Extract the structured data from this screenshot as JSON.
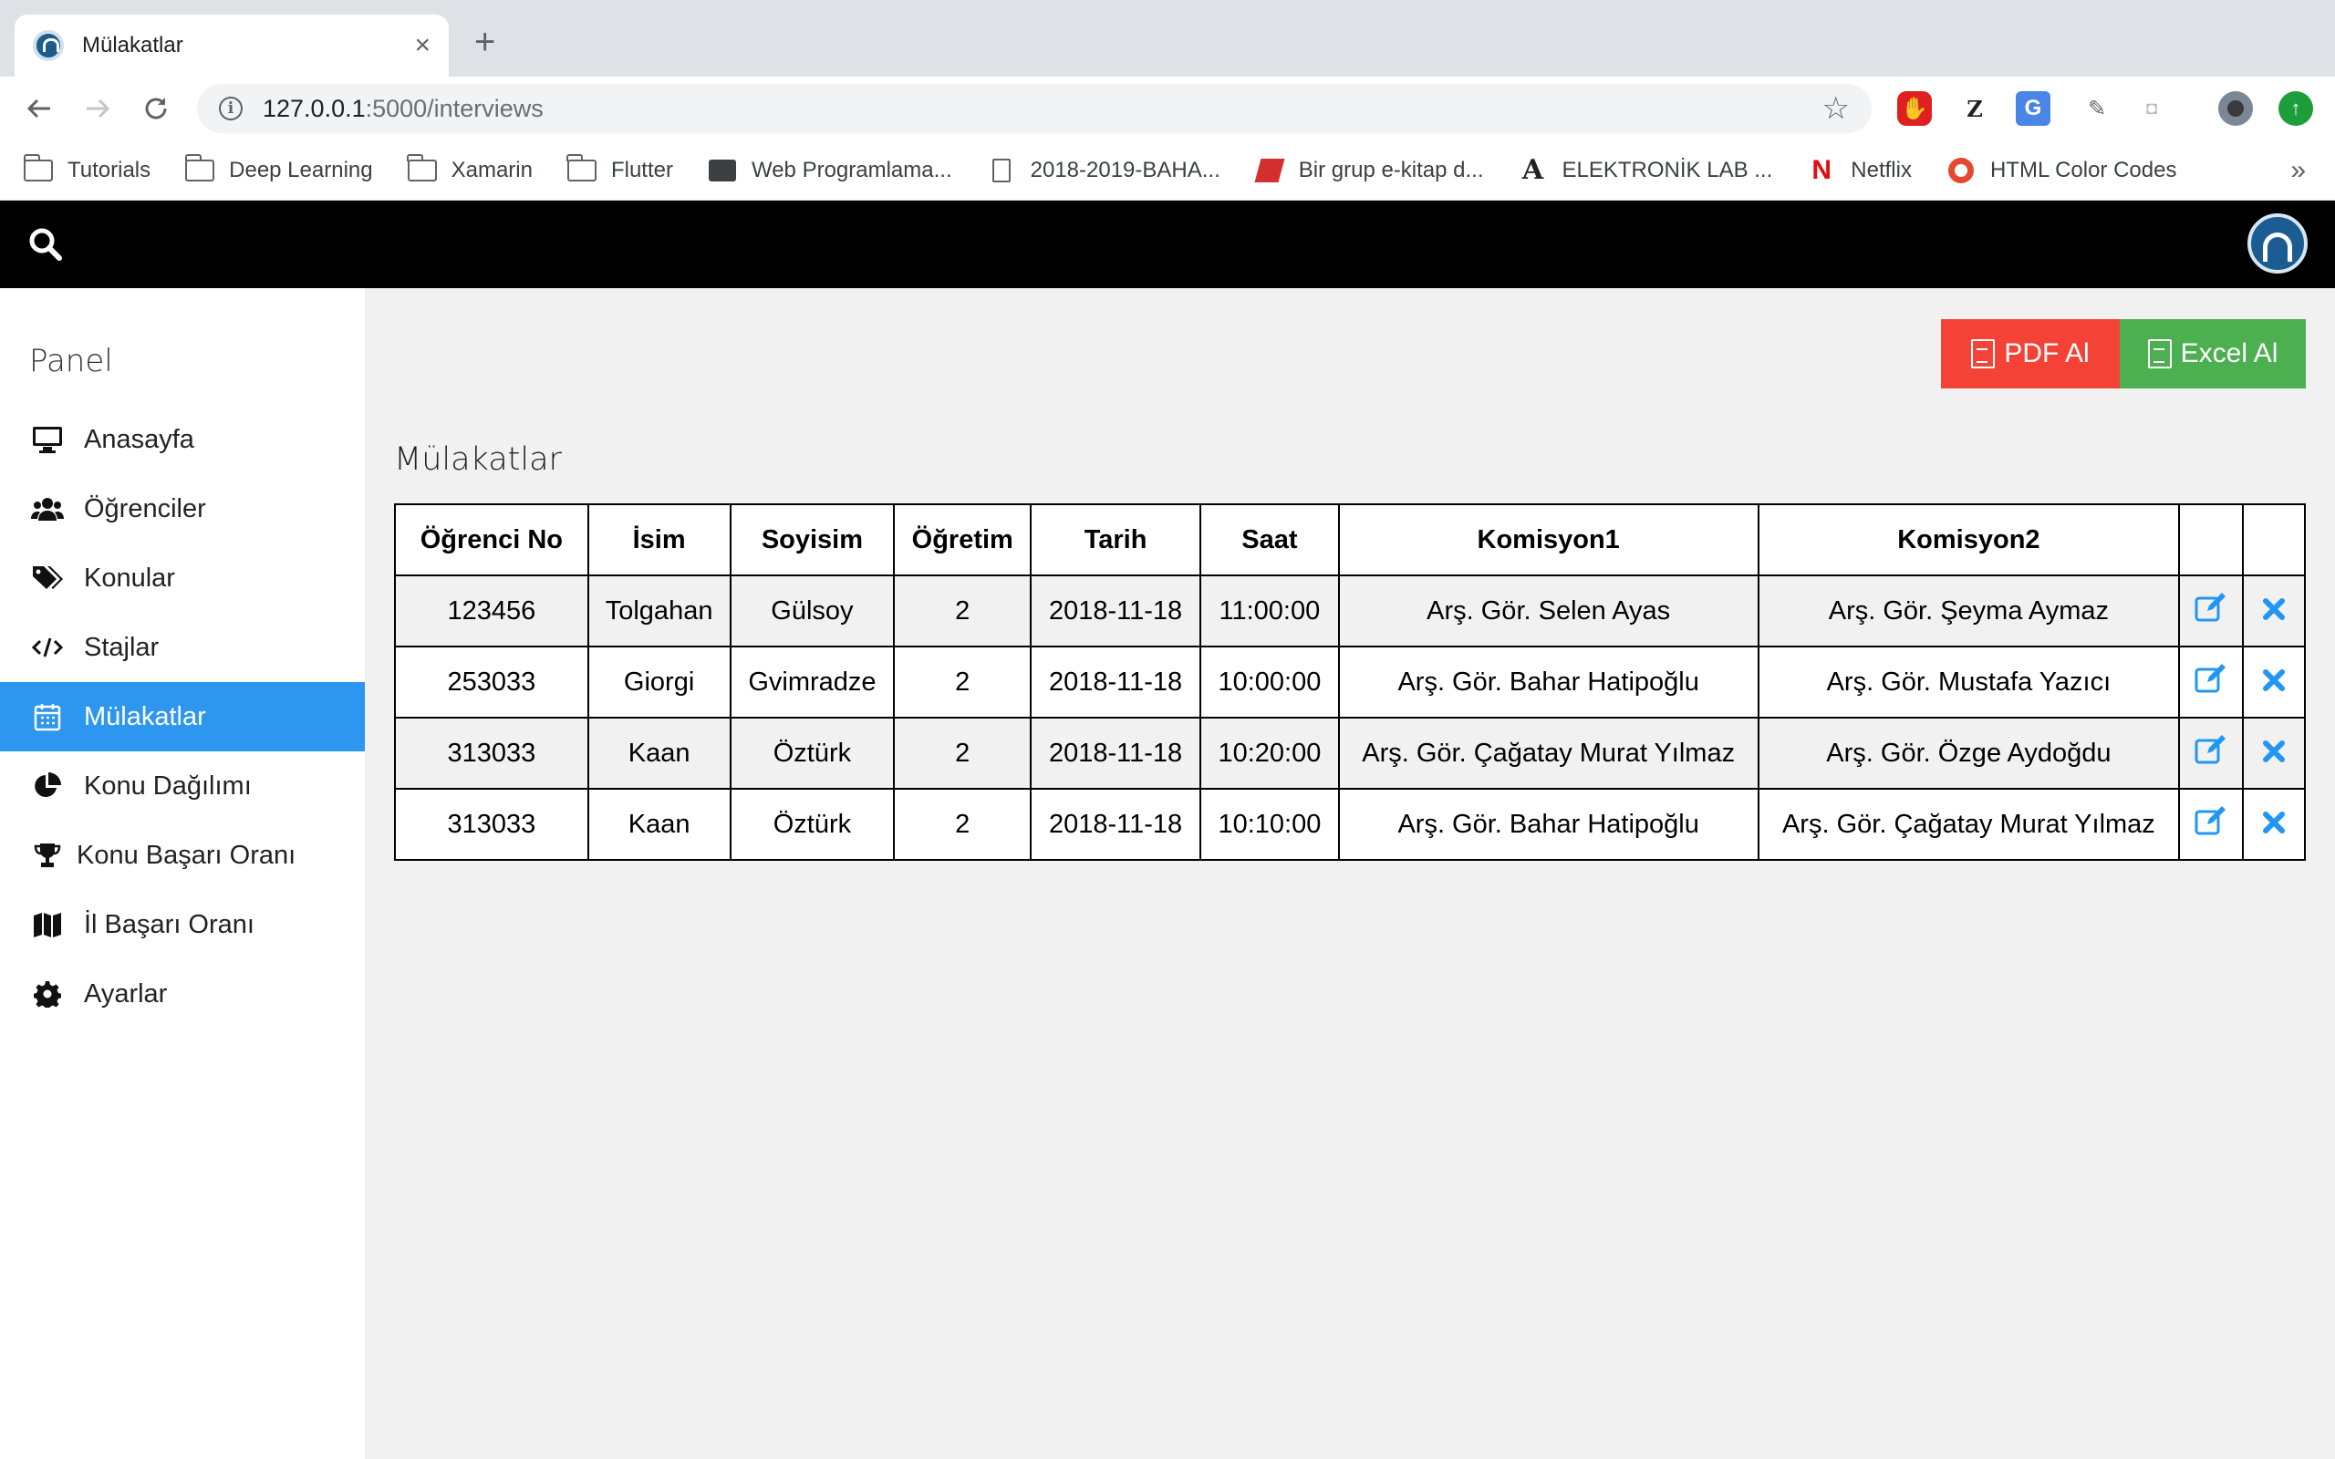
{
  "browser": {
    "tab_title": "Mülakatlar",
    "url_host": "127.0.0.1",
    "url_path": ":5000/interviews"
  },
  "bookmarks": [
    {
      "label": "Tutorials",
      "icon": "folder-icon"
    },
    {
      "label": "Deep Learning",
      "icon": "folder-icon"
    },
    {
      "label": "Xamarin",
      "icon": "folder-icon"
    },
    {
      "label": "Flutter",
      "icon": "folder-icon"
    },
    {
      "label": "Web Programlama...",
      "icon": "contact-icon"
    },
    {
      "label": "2018-2019-BAHA...",
      "icon": "document-icon"
    },
    {
      "label": "Bir grup e-kitap d...",
      "icon": "book-icon"
    },
    {
      "label": "ELEKTRONİK LAB ...",
      "icon": "font-a-icon"
    },
    {
      "label": "Netflix",
      "icon": "netflix-icon"
    },
    {
      "label": "HTML Color Codes",
      "icon": "color-wheel-icon"
    }
  ],
  "sidebar": {
    "title": "Panel",
    "items": [
      {
        "label": "Anasayfa",
        "icon": "desktop-icon"
      },
      {
        "label": "Öğrenciler",
        "icon": "users-icon"
      },
      {
        "label": "Konular",
        "icon": "tags-icon"
      },
      {
        "label": "Stajlar",
        "icon": "code-icon"
      },
      {
        "label": "Mülakatlar",
        "icon": "calendar-icon",
        "active": true
      },
      {
        "label": "Konu Dağılımı",
        "icon": "pie-chart-icon"
      },
      {
        "label": "Konu Başarı Oranı",
        "icon": "trophy-icon"
      },
      {
        "label": "İl Başarı Oranı",
        "icon": "map-icon"
      },
      {
        "label": "Ayarlar",
        "icon": "gear-icon"
      }
    ]
  },
  "actions": {
    "pdf_label": "PDF Al",
    "excel_label": "Excel Al",
    "pdf_color": "#f44336",
    "excel_color": "#4caf50"
  },
  "page_title": "Mülakatlar",
  "table": {
    "headers": [
      "Öğrenci No",
      "İsim",
      "Soyisim",
      "Öğretim",
      "Tarih",
      "Saat",
      "Komisyon1",
      "Komisyon2",
      "",
      ""
    ],
    "rows": [
      [
        "123456",
        "Tolgahan",
        "Gülsoy",
        "2",
        "2018-11-18",
        "11:00:00",
        "Arş. Gör. Selen Ayas",
        "Arş. Gör. Şeyma Aymaz"
      ],
      [
        "253033",
        "Giorgi",
        "Gvimradze",
        "2",
        "2018-11-18",
        "10:00:00",
        "Arş. Gör. Bahar Hatipoğlu",
        "Arş. Gör. Mustafa Yazıcı"
      ],
      [
        "313033",
        "Kaan",
        "Öztürk",
        "2",
        "2018-11-18",
        "10:20:00",
        "Arş. Gör. Çağatay Murat Yılmaz",
        "Arş. Gör. Özge Aydoğdu"
      ],
      [
        "313033",
        "Kaan",
        "Öztürk",
        "2",
        "2018-11-18",
        "10:10:00",
        "Arş. Gör. Bahar Hatipoğlu",
        "Arş. Gör. Çağatay Murat Yılmaz"
      ]
    ]
  },
  "colors": {
    "active_sidebar": "#2d96ee",
    "action_icon": "#2196f3"
  }
}
